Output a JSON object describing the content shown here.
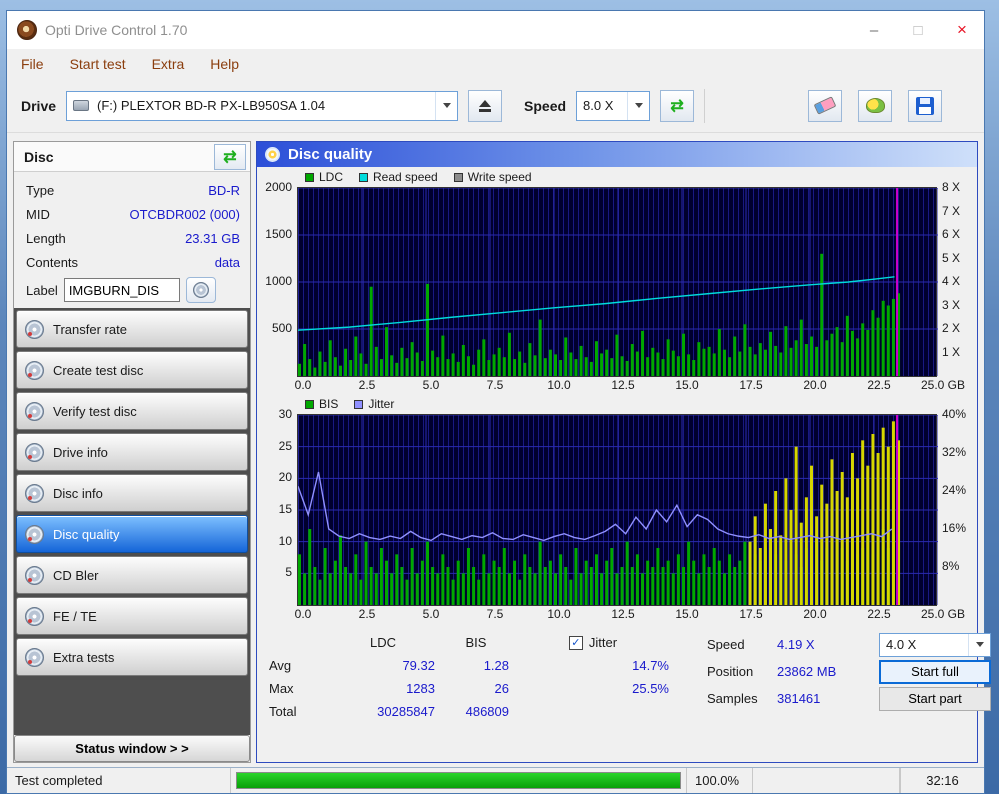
{
  "window": {
    "title": "Opti Drive Control 1.70"
  },
  "icons": {
    "minimize": "–",
    "maximize": "□",
    "close": "×",
    "refresh": "⇄",
    "check": "✓"
  },
  "menu": {
    "items": [
      "File",
      "Start test",
      "Extra",
      "Help"
    ]
  },
  "toolbar": {
    "drive_label": "Drive",
    "drive_value": "(F:)   PLEXTOR BD-R  PX-LB950SA 1.04",
    "speed_label": "Speed",
    "speed_value": "8.0 X"
  },
  "disc_panel": {
    "header": "Disc",
    "fields": [
      {
        "label": "Type",
        "value": "BD-R"
      },
      {
        "label": "MID",
        "value": "OTCBDR002 (000)"
      },
      {
        "label": "Length",
        "value": "23.31 GB"
      },
      {
        "label": "Contents",
        "value": "data"
      }
    ],
    "label_label": "Label",
    "label_value": "IMGBURN_DIS",
    "buttons": [
      "Transfer rate",
      "Create test disc",
      "Verify test disc",
      "Drive info",
      "Disc info",
      "Disc quality",
      "CD Bler",
      "FE / TE",
      "Extra tests"
    ],
    "selected_button": "Disc quality",
    "status_window": "Status window > >"
  },
  "main": {
    "title": "Disc quality"
  },
  "chart_data": [
    {
      "type": "bar",
      "name": "ldc-read-speed-chart",
      "legend": [
        {
          "label": "LDC",
          "color": "#00a800"
        },
        {
          "label": "Read speed",
          "color": "#00dcdc"
        },
        {
          "label": "Write speed",
          "color": "#8c8c8c"
        }
      ],
      "x_max": 25,
      "x_ticks": [
        0,
        2.5,
        5,
        7.5,
        10,
        12.5,
        15,
        17.5,
        20,
        22.5,
        25
      ],
      "x_tick_labels": [
        "0.0",
        "2.5",
        "5.0",
        "7.5",
        "10.0",
        "12.5",
        "15.0",
        "17.5",
        "20.0",
        "22.5",
        "25.0 GB"
      ],
      "left_max": 2000,
      "left_ticks": [
        2000,
        1500,
        1000,
        500
      ],
      "left_tick_labels": [
        "2000",
        "1500",
        "1000",
        "500"
      ],
      "right_axis_max": 8,
      "right_ticks": [
        8,
        7,
        6,
        5,
        4,
        3,
        2,
        1
      ],
      "right_tick_labels": [
        "8 X",
        "7 X",
        "6 X",
        "5 X",
        "4 X",
        "3 X",
        "2 X",
        "1 X"
      ],
      "end_marker_x": 23.4,
      "end_marker_color": "#cc00cc",
      "series": [
        {
          "name": "LDC",
          "type": "bars",
          "color": "#00a800",
          "step": 0.2,
          "start_x": 0,
          "values": [
            130,
            340,
            180,
            90,
            260,
            150,
            380,
            200,
            110,
            290,
            170,
            420,
            240,
            130,
            950,
            310,
            180,
            520,
            220,
            140,
            300,
            190,
            360,
            250,
            160,
            980,
            270,
            200,
            430,
            180,
            240,
            150,
            330,
            210,
            120,
            280,
            390,
            170,
            230,
            300,
            200,
            460,
            180,
            260,
            140,
            350,
            220,
            600,
            190,
            280,
            230,
            170,
            410,
            250,
            180,
            320,
            200,
            150,
            370,
            240,
            280,
            190,
            440,
            210,
            160,
            340,
            260,
            480,
            200,
            300,
            250,
            180,
            390,
            270,
            210,
            450,
            230,
            170,
            360,
            290,
            310,
            240,
            500,
            280,
            200,
            420,
            260,
            550,
            310,
            230,
            350,
            280,
            470,
            320,
            250,
            530,
            300,
            380,
            600,
            340,
            420,
            310,
            1300,
            380,
            450,
            520,
            360,
            640,
            480,
            400,
            560,
            490,
            700,
            620,
            800,
            750,
            820,
            880
          ]
        },
        {
          "name": "Read speed",
          "type": "line",
          "color": "#00dcdc",
          "axis_max": 8,
          "points": [
            [
              0,
              1.95
            ],
            [
              2,
              2.08
            ],
            [
              4,
              2.28
            ],
            [
              6,
              2.5
            ],
            [
              8,
              2.7
            ],
            [
              10,
              2.9
            ],
            [
              12,
              3.08
            ],
            [
              14,
              3.3
            ],
            [
              16,
              3.5
            ],
            [
              18,
              3.7
            ],
            [
              20,
              3.88
            ],
            [
              21.5,
              4.0
            ],
            [
              22.5,
              4.12
            ],
            [
              23.3,
              4.22
            ]
          ]
        },
        {
          "name": "Write speed",
          "type": "line",
          "color": "#8c8c8c",
          "axis_max": 8,
          "points": []
        }
      ]
    },
    {
      "type": "bar",
      "name": "bis-jitter-chart",
      "legend": [
        {
          "label": "BIS",
          "color": "#00a800"
        },
        {
          "label": "Jitter",
          "color": "#9090ff"
        }
      ],
      "x_max": 25,
      "x_ticks": [
        0,
        2.5,
        5,
        7.5,
        10,
        12.5,
        15,
        17.5,
        20,
        22.5,
        25
      ],
      "x_tick_labels": [
        "0.0",
        "2.5",
        "5.0",
        "7.5",
        "10.0",
        "12.5",
        "15.0",
        "17.5",
        "20.0",
        "22.5",
        "25.0 GB"
      ],
      "left_max": 30,
      "left_ticks": [
        30,
        25,
        20,
        15,
        10,
        5
      ],
      "left_tick_labels": [
        "30",
        "25",
        "20",
        "15",
        "10",
        "5"
      ],
      "right_axis_max": 40,
      "right_ticks": [
        40,
        32,
        24,
        16,
        8
      ],
      "right_tick_labels": [
        "40%",
        "32%",
        "24%",
        "16%",
        "8%"
      ],
      "end_marker_x": 23.4,
      "end_marker_color": "#cc00cc",
      "series": [
        {
          "name": "BIS",
          "type": "bars",
          "color": "#00a800",
          "step": 0.2,
          "start_x": 0,
          "values": [
            8,
            5,
            12,
            6,
            4,
            9,
            5,
            7,
            11,
            6,
            5,
            8,
            4,
            10,
            6,
            5,
            9,
            7,
            5,
            8,
            6,
            4,
            9,
            5,
            7,
            10,
            6,
            5,
            8,
            6,
            4,
            7,
            5,
            9,
            6,
            4,
            8,
            5,
            7,
            6,
            9,
            5,
            7,
            4,
            8,
            6,
            5,
            10,
            6,
            7,
            5,
            8,
            6,
            4,
            9,
            5,
            7,
            6,
            8,
            5,
            7,
            9,
            5,
            6,
            10,
            6,
            8,
            5,
            7,
            6,
            9,
            6,
            7,
            5,
            8,
            6,
            10,
            7,
            5,
            8,
            6,
            9,
            7,
            5,
            8,
            6,
            7,
            10,
            6,
            8,
            7,
            9,
            6,
            8,
            10,
            7,
            9,
            8,
            6,
            9,
            8,
            10,
            7,
            9,
            8,
            11,
            9,
            7,
            10,
            8,
            9,
            11,
            8,
            10,
            12,
            9,
            11,
            10
          ]
        },
        {
          "name": "BIS high",
          "type": "bars",
          "color": "#d6d600",
          "step": 0.2,
          "start_x": 17.6,
          "values": [
            10,
            14,
            9,
            16,
            12,
            18,
            11,
            20,
            15,
            25,
            13,
            17,
            22,
            14,
            19,
            16,
            23,
            18,
            21,
            17,
            24,
            20,
            26,
            22,
            27,
            24,
            28,
            25,
            29,
            26
          ]
        },
        {
          "name": "Jitter",
          "type": "line",
          "color": "#9090ff",
          "axis_max": 40,
          "step": 0.4,
          "start_x": 0,
          "values": [
            25,
            19,
            28,
            16,
            14.5,
            14,
            15,
            14.2,
            13.8,
            14.5,
            14,
            15.5,
            14.2,
            13.6,
            15,
            14.4,
            13.8,
            14.6,
            14.2,
            15.2,
            14,
            13.8,
            14.8,
            14.2,
            13.6,
            14.4,
            15,
            14.2,
            13.8,
            14.6,
            15.5,
            17,
            15,
            18.5,
            16,
            20,
            17.5,
            21,
            16.5,
            19,
            18,
            16,
            15,
            14.5,
            14.2,
            14.8,
            14,
            14.4,
            13.8,
            14.2,
            14.6,
            14,
            14.4,
            13.8,
            14.2,
            14.6,
            15,
            14.4,
            16
          ]
        }
      ]
    }
  ],
  "stats": {
    "col_ldc": "LDC",
    "col_bis": "BIS",
    "col_jitter": "Jitter",
    "rows": {
      "avg": {
        "label": "Avg",
        "ldc": "79.32",
        "bis": "1.28",
        "jitter": "14.7%"
      },
      "max": {
        "label": "Max",
        "ldc": "1283",
        "bis": "26",
        "jitter": "25.5%"
      },
      "total": {
        "label": "Total",
        "ldc": "30285847",
        "bis": "486809",
        "jitter": ""
      }
    },
    "speed_label": "Speed",
    "speed_value": "4.19 X",
    "speed_select": "4.0 X",
    "position_label": "Position",
    "position_value": "23862 MB",
    "samples_label": "Samples",
    "samples_value": "381461",
    "start_full": "Start full",
    "start_part": "Start part"
  },
  "status_bar": {
    "status": "Test completed",
    "progress_pct": 100,
    "progress_text": "100.0%",
    "time": "32:16"
  }
}
